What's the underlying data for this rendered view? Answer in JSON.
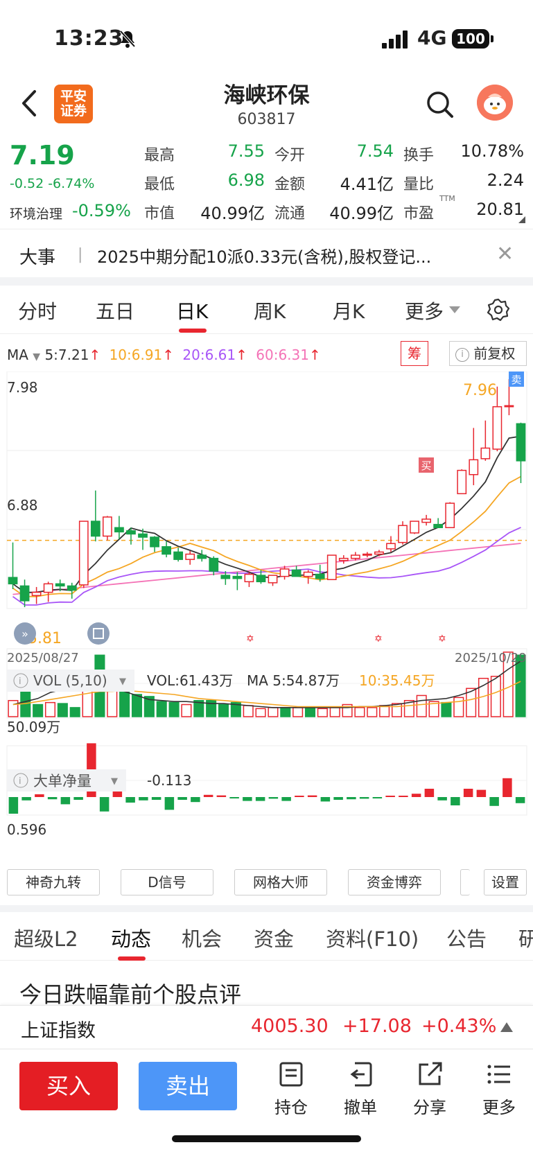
{
  "status_bar": {
    "time": "13:23",
    "network": "4G",
    "battery": "100"
  },
  "header": {
    "broker_logo": "平安\n证券",
    "stock_name": "海峡环保",
    "stock_code": "603817"
  },
  "quote": {
    "price": "7.19",
    "change": "-0.52 -6.74%",
    "sector": "环境治理",
    "sector_change": "-0.59%",
    "fields": [
      {
        "label": "最高",
        "value": "7.55",
        "color": "green"
      },
      {
        "label": "今开",
        "value": "7.54",
        "color": "green"
      },
      {
        "label": "换手",
        "value": "10.78%",
        "color": "black"
      },
      {
        "label": "最低",
        "value": "6.98",
        "color": "green"
      },
      {
        "label": "金额",
        "value": "4.41亿",
        "color": "black"
      },
      {
        "label": "量比",
        "value": "2.24",
        "color": "black"
      },
      {
        "label": "市值",
        "value": "40.99亿",
        "color": "black"
      },
      {
        "label": "流通",
        "value": "40.99亿",
        "color": "black"
      },
      {
        "label": "市盈",
        "value": "20.81",
        "color": "black"
      }
    ],
    "pe_sup": "TTM"
  },
  "events": {
    "label": "大事",
    "text": "2025中期分配10派0.33元(含税),股权登记..."
  },
  "period_tabs": [
    "分时",
    "五日",
    "日K",
    "周K",
    "月K",
    "更多"
  ],
  "active_period": "日K",
  "ma_legend": {
    "label": "MA",
    "ma5": "5:7.21",
    "ma10": "10:6.91",
    "ma20": "20:6.61",
    "ma60": "60:6.31",
    "colors": {
      "ma5": "#333333",
      "ma10": "#f5a623",
      "ma20": "#a855f7",
      "ma60": "#f472b6"
    }
  },
  "chip_button": "筹",
  "adjust_button": "前复权",
  "kline": {
    "y_top": "7.98",
    "y_mid": "6.88",
    "y_bottom": "5.81",
    "high_mark": "7.96",
    "start_date": "2025/08/27",
    "end_date": "2025/10/29",
    "buy_mark": "买",
    "sell_mark": "卖"
  },
  "volume": {
    "label": "VOL (5,10)",
    "vol": "VOL:61.43万",
    "ma5": "MA  5:54.87万",
    "ma10": "10:35.45万",
    "axis": "50.09万"
  },
  "bigorder": {
    "label": "大单净量",
    "value": "-0.113",
    "axis": "0.596"
  },
  "chart_data": [
    {
      "type": "candlestick",
      "title": "",
      "x_range": [
        "2025/08/27",
        "2025/10/29"
      ],
      "ylim": [
        5.81,
        7.98
      ],
      "candles": [
        {
          "o": 6.09,
          "h": 6.42,
          "l": 5.98,
          "c": 6.03
        },
        {
          "o": 6.01,
          "h": 6.07,
          "l": 5.81,
          "c": 5.87
        },
        {
          "o": 5.92,
          "h": 6.0,
          "l": 5.84,
          "c": 5.95
        },
        {
          "o": 5.95,
          "h": 6.05,
          "l": 5.86,
          "c": 6.03
        },
        {
          "o": 6.03,
          "h": 6.07,
          "l": 5.96,
          "c": 6.01
        },
        {
          "o": 6.01,
          "h": 6.04,
          "l": 5.89,
          "c": 5.97
        },
        {
          "o": 6.02,
          "h": 6.62,
          "l": 5.99,
          "c": 6.62
        },
        {
          "o": 6.62,
          "h": 6.91,
          "l": 6.43,
          "c": 6.48
        },
        {
          "o": 6.48,
          "h": 6.67,
          "l": 6.44,
          "c": 6.66
        },
        {
          "o": 6.56,
          "h": 6.67,
          "l": 6.45,
          "c": 6.52
        },
        {
          "o": 6.53,
          "h": 6.56,
          "l": 6.4,
          "c": 6.5
        },
        {
          "o": 6.5,
          "h": 6.55,
          "l": 6.35,
          "c": 6.47
        },
        {
          "o": 6.47,
          "h": 6.48,
          "l": 6.33,
          "c": 6.38
        },
        {
          "o": 6.38,
          "h": 6.43,
          "l": 6.28,
          "c": 6.31
        },
        {
          "o": 6.33,
          "h": 6.37,
          "l": 6.24,
          "c": 6.26
        },
        {
          "o": 6.26,
          "h": 6.34,
          "l": 6.21,
          "c": 6.31
        },
        {
          "o": 6.3,
          "h": 6.35,
          "l": 6.24,
          "c": 6.27
        },
        {
          "o": 6.27,
          "h": 6.29,
          "l": 6.11,
          "c": 6.15
        },
        {
          "o": 6.11,
          "h": 6.15,
          "l": 6.02,
          "c": 6.08
        },
        {
          "o": 6.1,
          "h": 6.14,
          "l": 5.97,
          "c": 6.08
        },
        {
          "o": 6.05,
          "h": 6.14,
          "l": 6.0,
          "c": 6.12
        },
        {
          "o": 6.11,
          "h": 6.16,
          "l": 6.03,
          "c": 6.05
        },
        {
          "o": 6.04,
          "h": 6.11,
          "l": 6.01,
          "c": 6.11
        },
        {
          "o": 6.1,
          "h": 6.2,
          "l": 6.07,
          "c": 6.17
        },
        {
          "o": 6.16,
          "h": 6.2,
          "l": 6.1,
          "c": 6.1
        },
        {
          "o": 6.1,
          "h": 6.16,
          "l": 6.03,
          "c": 6.14
        },
        {
          "o": 6.12,
          "h": 6.21,
          "l": 6.05,
          "c": 6.08
        },
        {
          "o": 6.07,
          "h": 6.3,
          "l": 6.07,
          "c": 6.3
        },
        {
          "o": 6.25,
          "h": 6.3,
          "l": 6.22,
          "c": 6.27
        },
        {
          "o": 6.27,
          "h": 6.33,
          "l": 6.25,
          "c": 6.3
        },
        {
          "o": 6.3,
          "h": 6.33,
          "l": 6.28,
          "c": 6.31
        },
        {
          "o": 6.31,
          "h": 6.35,
          "l": 6.29,
          "c": 6.33
        },
        {
          "o": 6.36,
          "h": 6.48,
          "l": 6.33,
          "c": 6.41
        },
        {
          "o": 6.42,
          "h": 6.62,
          "l": 6.4,
          "c": 6.58
        },
        {
          "o": 6.51,
          "h": 6.62,
          "l": 6.5,
          "c": 6.62
        },
        {
          "o": 6.61,
          "h": 6.68,
          "l": 6.58,
          "c": 6.64
        },
        {
          "o": 6.59,
          "h": 6.65,
          "l": 6.57,
          "c": 6.56
        },
        {
          "o": 6.56,
          "h": 6.8,
          "l": 6.56,
          "c": 6.79
        },
        {
          "o": 6.88,
          "h": 7.11,
          "l": 6.88,
          "c": 7.1
        },
        {
          "o": 7.06,
          "h": 7.5,
          "l": 6.96,
          "c": 7.2
        },
        {
          "o": 7.21,
          "h": 7.57,
          "l": 7.19,
          "c": 7.31
        },
        {
          "o": 7.3,
          "h": 7.89,
          "l": 7.28,
          "c": 7.7
        },
        {
          "o": 7.71,
          "h": 7.96,
          "l": 7.62,
          "c": 7.71
        },
        {
          "o": 7.54,
          "h": 7.55,
          "l": 6.98,
          "c": 7.19
        }
      ]
    },
    {
      "type": "bar",
      "title": "VOL (5,10)",
      "unit": "万",
      "values": [
        16,
        26,
        12,
        14,
        13,
        9,
        38,
        61,
        33,
        30,
        22,
        20,
        15,
        14,
        12,
        16,
        16,
        12,
        14,
        11,
        8,
        9,
        9,
        9,
        9,
        8,
        9,
        12,
        9,
        9,
        11,
        13,
        16,
        21,
        15,
        14,
        19,
        28,
        38,
        40,
        64,
        61
      ],
      "colors": [
        "r",
        "g",
        "g",
        "r",
        "g",
        "g",
        "r",
        "g",
        "r",
        "g",
        "g",
        "g",
        "g",
        "g",
        "r",
        "g",
        "g",
        "g",
        "g",
        "r",
        "r",
        "r",
        "g",
        "r",
        "g",
        "r",
        "r",
        "r",
        "r",
        "r",
        "r",
        "r",
        "r",
        "r",
        "r",
        "g",
        "r",
        "r",
        "r",
        "r",
        "r",
        "g"
      ],
      "ma5": [
        12,
        15,
        18,
        24,
        27,
        32,
        34,
        34,
        29,
        25,
        21,
        17,
        16,
        15,
        15,
        14,
        13,
        13,
        12,
        11,
        10,
        9,
        9,
        9,
        9,
        9,
        9,
        9,
        10,
        10,
        11,
        12,
        14,
        16,
        17,
        18,
        21,
        25,
        31,
        38,
        47,
        55
      ],
      "ma10": [
        12,
        13,
        15,
        17,
        19,
        21,
        23,
        25,
        25,
        26,
        25,
        24,
        23,
        22,
        20,
        18,
        17,
        16,
        15,
        14,
        13,
        12,
        11,
        10,
        10,
        10,
        10,
        10,
        10,
        10,
        10,
        10,
        11,
        12,
        13,
        14,
        15,
        17,
        20,
        24,
        29,
        35
      ]
    },
    {
      "type": "bar",
      "title": "大单净量",
      "values": [
        -0.3,
        -0.06,
        0.05,
        -0.04,
        -0.13,
        -0.05,
        0.97,
        -0.26,
        0.3,
        -0.1,
        -0.06,
        -0.05,
        -0.23,
        -0.05,
        -0.09,
        0.04,
        0.03,
        -0.02,
        -0.07,
        -0.07,
        -0.03,
        -0.07,
        0.02,
        0.03,
        -0.08,
        -0.05,
        -0.04,
        -0.03,
        -0.02,
        0.01,
        0.02,
        0.06,
        0.15,
        -0.06,
        -0.15,
        0.15,
        0.13,
        -0.16,
        0.34,
        -0.11
      ]
    }
  ],
  "tool_buttons": [
    "神奇九转",
    "D信号",
    "网格大师",
    "资金博弈",
    "设置"
  ],
  "feature_tabs": [
    "超级L2",
    "动态",
    "机会",
    "资金",
    "资料(F10)",
    "公告",
    "研"
  ],
  "active_feature": "动态",
  "news_title": "今日跌幅靠前个股点评",
  "index": {
    "name": "上证指数",
    "value": "4005.30",
    "change": "+17.08",
    "pct": "+0.43%"
  },
  "actions": {
    "buy": "买入",
    "sell": "卖出",
    "items": [
      "持仓",
      "撤单",
      "分享",
      "更多"
    ]
  }
}
